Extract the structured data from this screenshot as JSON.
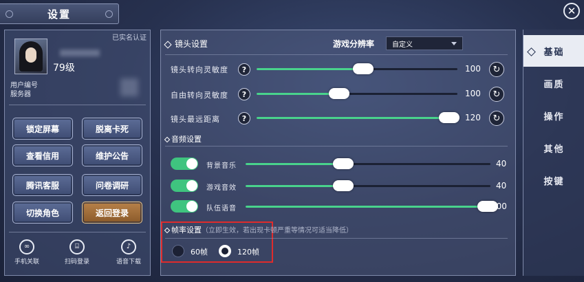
{
  "header": {
    "title": "设置",
    "close_icon": "close-icon"
  },
  "profile": {
    "verified": "已实名认证",
    "level": "79级",
    "user_id_label": "用户编号",
    "server_label": "服务器"
  },
  "actions": [
    {
      "label": "锁定屏幕"
    },
    {
      "label": "脱离卡死"
    },
    {
      "label": "查看信用"
    },
    {
      "label": "维护公告"
    },
    {
      "label": "腾讯客服"
    },
    {
      "label": "问卷调研"
    },
    {
      "label": "切换角色"
    },
    {
      "label": "返回登录"
    }
  ],
  "bottom_links": [
    {
      "label": "手机关联",
      "icon": "link-icon"
    },
    {
      "label": "扫码登录",
      "icon": "scan-icon"
    },
    {
      "label": "语音下载",
      "icon": "music-note-icon"
    }
  ],
  "camera": {
    "title": "镜头设置",
    "resolution_label": "游戏分辨率",
    "resolution_value": "自定义",
    "rows": [
      {
        "label": "镜头转向灵敏度",
        "value": "100",
        "fraction": 0.53
      },
      {
        "label": "自由转向灵敏度",
        "value": "100",
        "fraction": 0.41
      },
      {
        "label": "镜头最远距离",
        "value": "120",
        "fraction": 0.96
      }
    ]
  },
  "audio": {
    "title": "音频设置",
    "rows": [
      {
        "label": "背景音乐",
        "value": "40",
        "fraction": 0.4,
        "enabled": true
      },
      {
        "label": "游戏音效",
        "value": "40",
        "fraction": 0.4,
        "enabled": true
      },
      {
        "label": "队伍语音",
        "value": "100",
        "fraction": 0.99,
        "enabled": true
      }
    ]
  },
  "framerate": {
    "title": "帧率设置",
    "note": "（立即生效，若出现卡顿严重等情况可适当降低）",
    "options": [
      {
        "label": "60帧",
        "selected": false
      },
      {
        "label": "120帧",
        "selected": true
      }
    ]
  },
  "tabs": [
    {
      "label": "基础",
      "active": true
    },
    {
      "label": "画质"
    },
    {
      "label": "操作"
    },
    {
      "label": "其他"
    },
    {
      "label": "按键"
    }
  ]
}
